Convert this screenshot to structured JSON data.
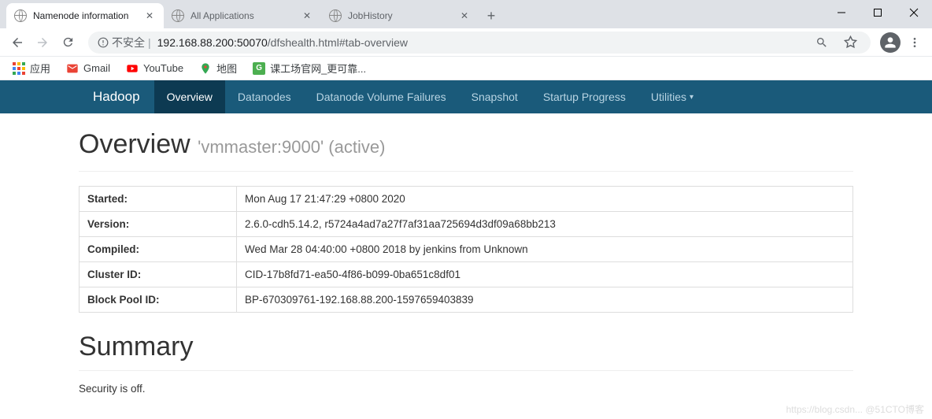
{
  "window": {
    "tabs": [
      {
        "title": "Namenode information",
        "active": true
      },
      {
        "title": "All Applications",
        "active": false
      },
      {
        "title": "JobHistory",
        "active": false
      }
    ]
  },
  "addressbar": {
    "security_label": "不安全",
    "host": "192.168.88.200:50070",
    "path": "/dfshealth.html#tab-overview"
  },
  "bookmarks": {
    "apps_label": "应用",
    "items": [
      {
        "label": "Gmail"
      },
      {
        "label": "YouTube"
      },
      {
        "label": "地图"
      },
      {
        "label": "课工场官网_更可靠..."
      }
    ]
  },
  "hadoop": {
    "brand": "Hadoop",
    "nav": [
      {
        "label": "Overview",
        "active": true
      },
      {
        "label": "Datanodes"
      },
      {
        "label": "Datanode Volume Failures"
      },
      {
        "label": "Snapshot"
      },
      {
        "label": "Startup Progress"
      },
      {
        "label": "Utilities",
        "dropdown": true
      }
    ]
  },
  "overview": {
    "title": "Overview",
    "subtitle": "'vmmaster:9000' (active)",
    "rows": [
      {
        "key": "Started:",
        "val": "Mon Aug 17 21:47:29 +0800 2020"
      },
      {
        "key": "Version:",
        "val": "2.6.0-cdh5.14.2, r5724a4ad7a27f7af31aa725694d3df09a68bb213"
      },
      {
        "key": "Compiled:",
        "val": "Wed Mar 28 04:40:00 +0800 2018 by jenkins from Unknown"
      },
      {
        "key": "Cluster ID:",
        "val": "CID-17b8fd71-ea50-4f86-b099-0ba651c8df01"
      },
      {
        "key": "Block Pool ID:",
        "val": "BP-670309761-192.168.88.200-1597659403839"
      }
    ]
  },
  "summary": {
    "title": "Summary",
    "security": "Security is off."
  },
  "watermark": "https://blog.csdn... @51CTO博客"
}
